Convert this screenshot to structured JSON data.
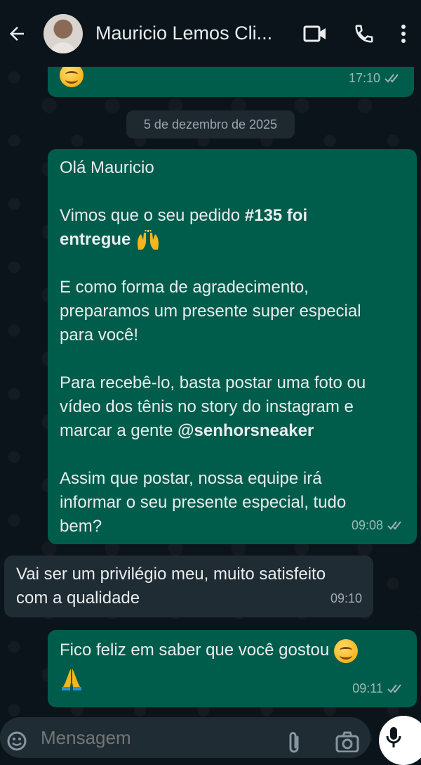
{
  "header": {
    "contact_name": "Mauricio Lemos Cli..."
  },
  "messages": {
    "m1": {
      "time": "17:10"
    },
    "date_chip": "5 de dezembro de 2025",
    "m2": {
      "p1": "Olá Mauricio",
      "p2_prefix": "Vimos que o seu pedido ",
      "p2_bold": "#135 foi",
      "p2_bold2": "entregue",
      "p3": "E como forma de agradecimento,\npreparamos um presente super especial\npara você!",
      "p4_prefix": "Para recebê-lo, basta postar uma foto ou\nvídeo dos tênis no story do instagram e\nmarcar a gente ",
      "p4_bold": "@senhorsneaker",
      "p5": "Assim que postar, nossa equipe irá\ninformar o seu presente especial, tudo\nbem?",
      "time": "09:08"
    },
    "m3": {
      "text": "Vai ser um privilégio meu, muito satisfeito\ncom a qualidade",
      "time": "09:10"
    },
    "m4": {
      "text": "Fico feliz em saber que você gostou ",
      "time": "09:11"
    }
  },
  "composer": {
    "placeholder": "Mensagem"
  }
}
